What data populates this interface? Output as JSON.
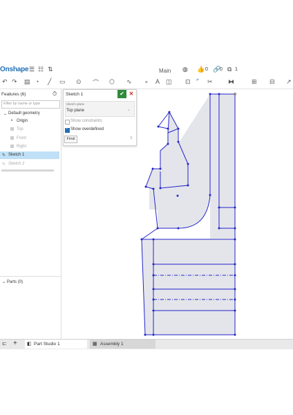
{
  "app": {
    "logo": "Onshape",
    "doc_tab": "Main",
    "likes": "0",
    "links": "0",
    "copies": "1"
  },
  "toolbar": {
    "icons": [
      "undo-icon",
      "redo-icon",
      "table-icon",
      "sketch-icon",
      "line-icon",
      "rectangle-icon",
      "circle-icon",
      "arc-icon",
      "polygon-icon",
      "spline-icon",
      "point-icon",
      "text-icon",
      "construction-icon",
      "offset-icon",
      "fillet-icon",
      "trim-icon",
      "mirror-icon",
      "pattern-icon",
      "dimension-icon"
    ]
  },
  "features_panel": {
    "title": "Features (6)",
    "filter_placeholder": "Filter by name or type",
    "default_geometry": "Default geometry",
    "origin": "Origin",
    "top": "Top",
    "front": "Front",
    "right": "Right",
    "sketch1": "Sketch 1",
    "sketch2": "Sketch 2",
    "parts": "Parts (0)"
  },
  "sketch_dialog": {
    "title": "Sketch 1",
    "plane_label": "Sketch plane",
    "plane_value": "Top plane",
    "show_constraints": "Show constraints",
    "show_constraints_checked": false,
    "show_overdefined": "Show overdefined",
    "show_overdefined_checked": true,
    "final_button": "Final"
  },
  "bottom_tabs": {
    "tab1": "Part Studio 1",
    "tab2": "Assembly 1"
  },
  "colors": {
    "accent": "#1f6fb5",
    "sketch_line": "#2323c8",
    "sketch_fill": "#e3e5eb",
    "confirm": "#2e8b3a",
    "cancel": "#d02b20",
    "selection": "#bfe0f6"
  }
}
